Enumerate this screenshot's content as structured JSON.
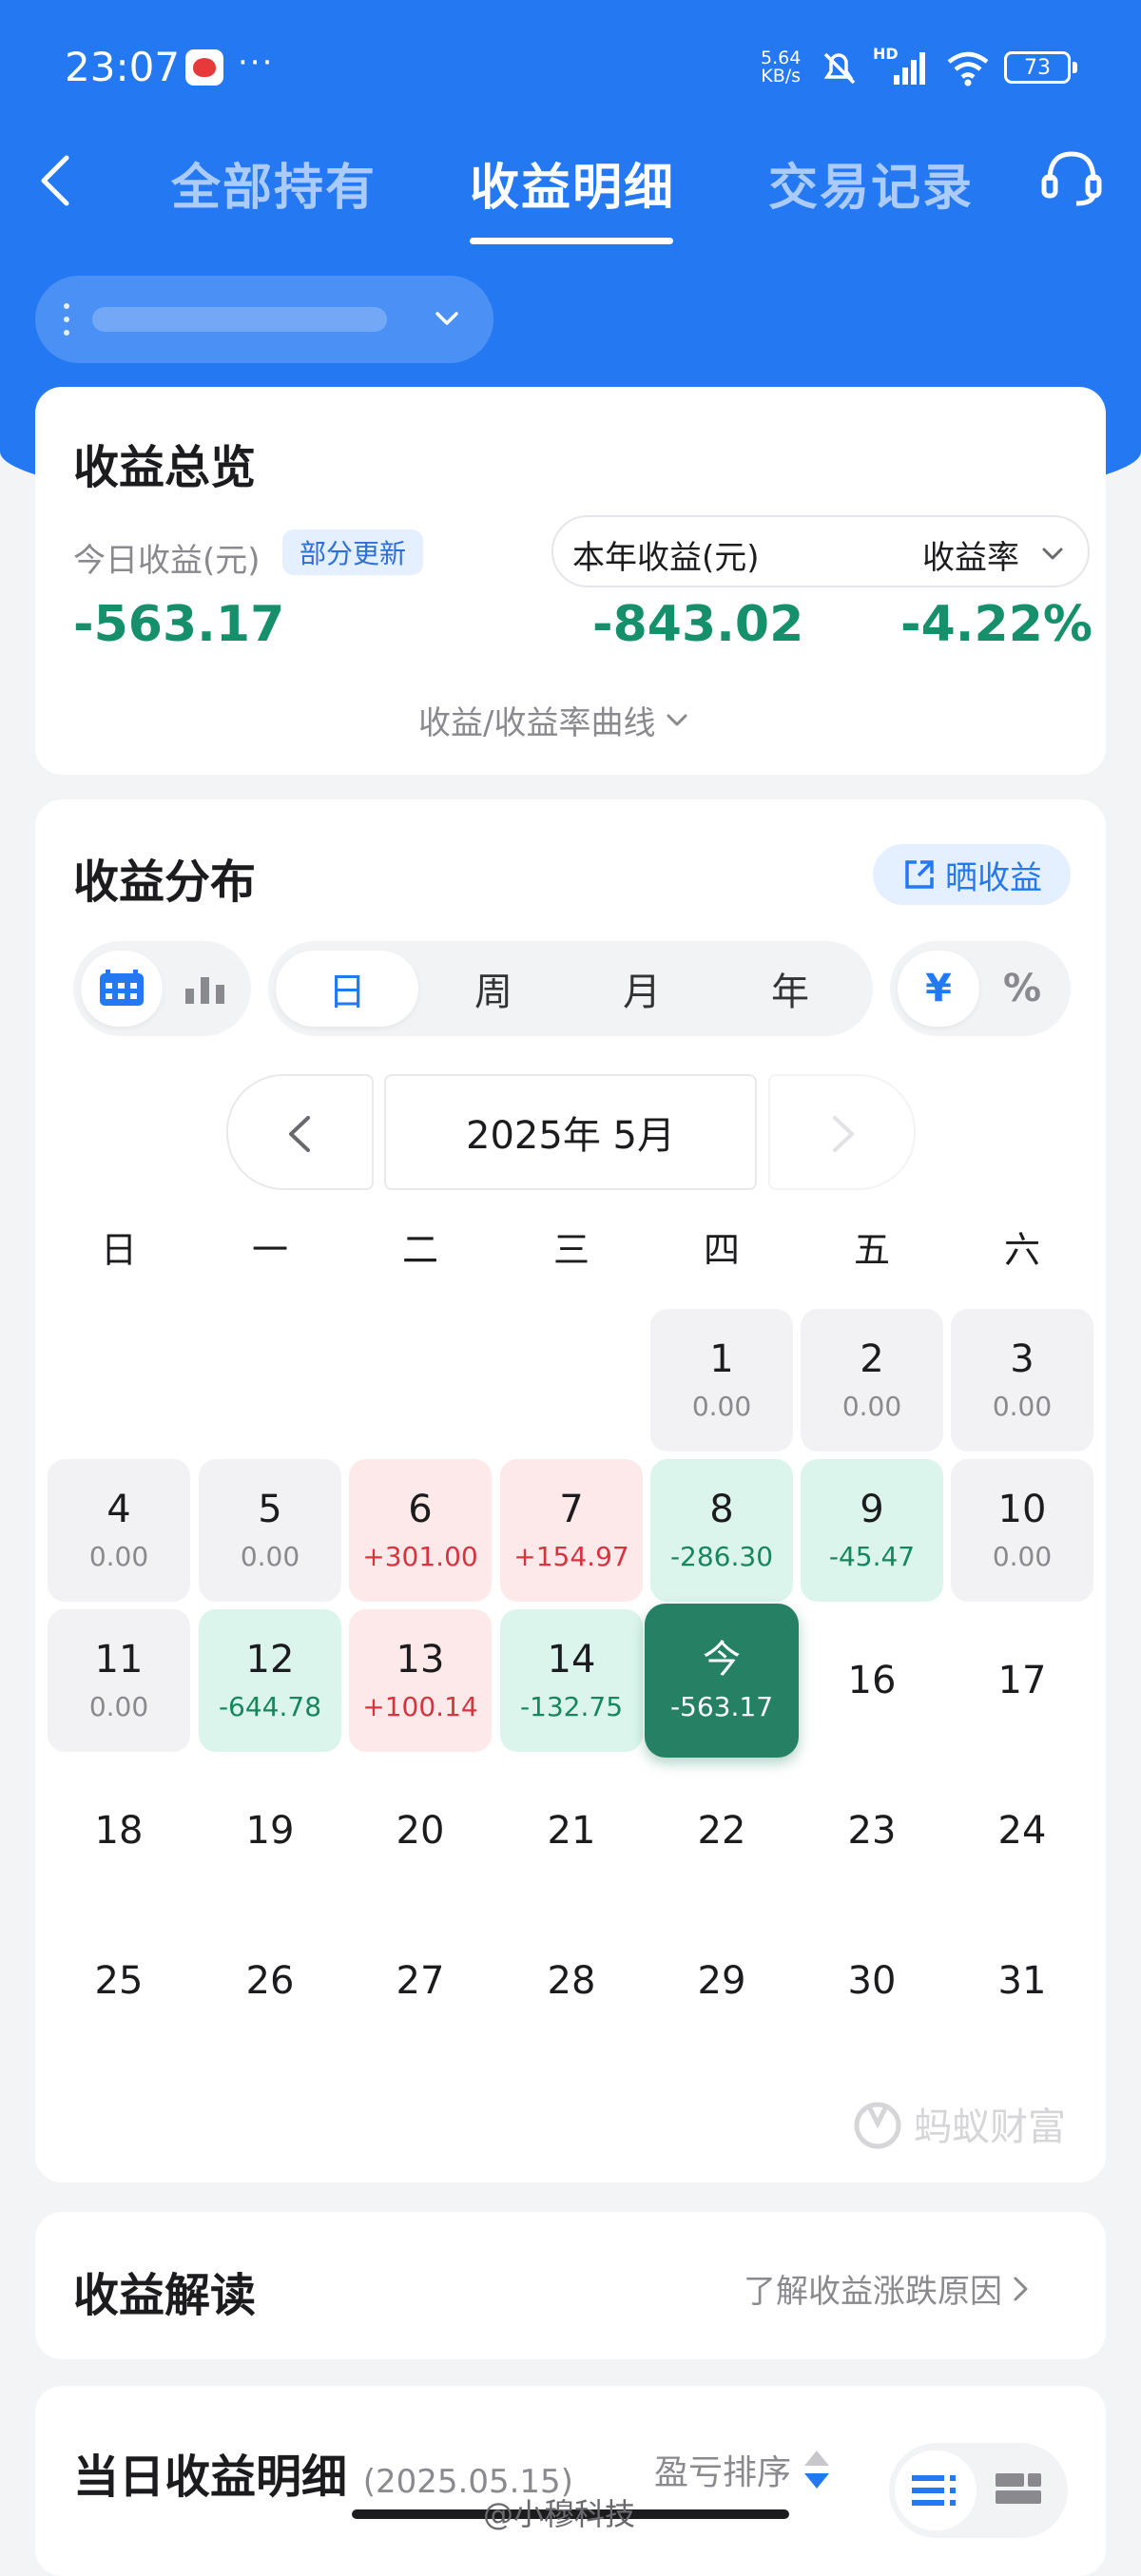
{
  "status_bar": {
    "time": "23:07",
    "dots": "···",
    "net_speed_value": "5.64",
    "net_speed_unit": "KB/s",
    "hd": "HD",
    "battery": "73"
  },
  "nav": {
    "tabs": [
      {
        "label": "全部持有",
        "active": false
      },
      {
        "label": "收益明细",
        "active": true
      },
      {
        "label": "交易记录",
        "active": false
      }
    ]
  },
  "overview": {
    "title": "收益总览",
    "today_label": "今日收益(元)",
    "update_badge": "部分更新",
    "today_value": "-563.17",
    "year_label": "本年收益(元)",
    "rate_label": "收益率",
    "year_value": "-843.02",
    "rate_value": "-4.22%",
    "curve_link": "收益/收益率曲线"
  },
  "distribution": {
    "title": "收益分布",
    "share_label": "晒收益",
    "periods": [
      "日",
      "周",
      "月",
      "年"
    ],
    "selected_period": "日",
    "units": [
      "¥",
      "%"
    ],
    "selected_unit": "¥",
    "month_label": "2025年 5月",
    "weekdays": [
      "日",
      "一",
      "二",
      "三",
      "四",
      "五",
      "六"
    ],
    "days": [
      {
        "d": "1",
        "v": "0.00",
        "t": "zero"
      },
      {
        "d": "2",
        "v": "0.00",
        "t": "zero"
      },
      {
        "d": "3",
        "v": "0.00",
        "t": "zero"
      },
      {
        "d": "4",
        "v": "0.00",
        "t": "zero"
      },
      {
        "d": "5",
        "v": "0.00",
        "t": "zero"
      },
      {
        "d": "6",
        "v": "+301.00",
        "t": "pos"
      },
      {
        "d": "7",
        "v": "+154.97",
        "t": "pos"
      },
      {
        "d": "8",
        "v": "-286.30",
        "t": "neg"
      },
      {
        "d": "9",
        "v": "-45.47",
        "t": "neg"
      },
      {
        "d": "10",
        "v": "0.00",
        "t": "zero"
      },
      {
        "d": "11",
        "v": "0.00",
        "t": "zero"
      },
      {
        "d": "12",
        "v": "-644.78",
        "t": "neg"
      },
      {
        "d": "13",
        "v": "+100.14",
        "t": "pos"
      },
      {
        "d": "14",
        "v": "-132.75",
        "t": "neg"
      },
      {
        "d": "今",
        "v": "-563.17",
        "t": "today"
      },
      {
        "d": "16",
        "v": "",
        "t": "future"
      },
      {
        "d": "17",
        "v": "",
        "t": "future"
      },
      {
        "d": "18",
        "v": "",
        "t": "future"
      },
      {
        "d": "19",
        "v": "",
        "t": "future"
      },
      {
        "d": "20",
        "v": "",
        "t": "future"
      },
      {
        "d": "21",
        "v": "",
        "t": "future"
      },
      {
        "d": "22",
        "v": "",
        "t": "future"
      },
      {
        "d": "23",
        "v": "",
        "t": "future"
      },
      {
        "d": "24",
        "v": "",
        "t": "future"
      },
      {
        "d": "25",
        "v": "",
        "t": "future"
      },
      {
        "d": "26",
        "v": "",
        "t": "future"
      },
      {
        "d": "27",
        "v": "",
        "t": "future"
      },
      {
        "d": "28",
        "v": "",
        "t": "future"
      },
      {
        "d": "29",
        "v": "",
        "t": "future"
      },
      {
        "d": "30",
        "v": "",
        "t": "future"
      },
      {
        "d": "31",
        "v": "",
        "t": "future"
      }
    ],
    "brand_watermark": "蚂蚁财富"
  },
  "interpretation": {
    "title": "收益解读",
    "link": "了解收益涨跌原因"
  },
  "daily_detail": {
    "title": "当日收益明细",
    "date": "(2025.05.15)",
    "sort_label": "盈亏排序"
  },
  "watermark": "@小穆科技",
  "colors": {
    "primary_blue": "#2478f2",
    "gain_red": "#d6343f",
    "loss_green": "#17865f",
    "today_green": "#268064"
  }
}
